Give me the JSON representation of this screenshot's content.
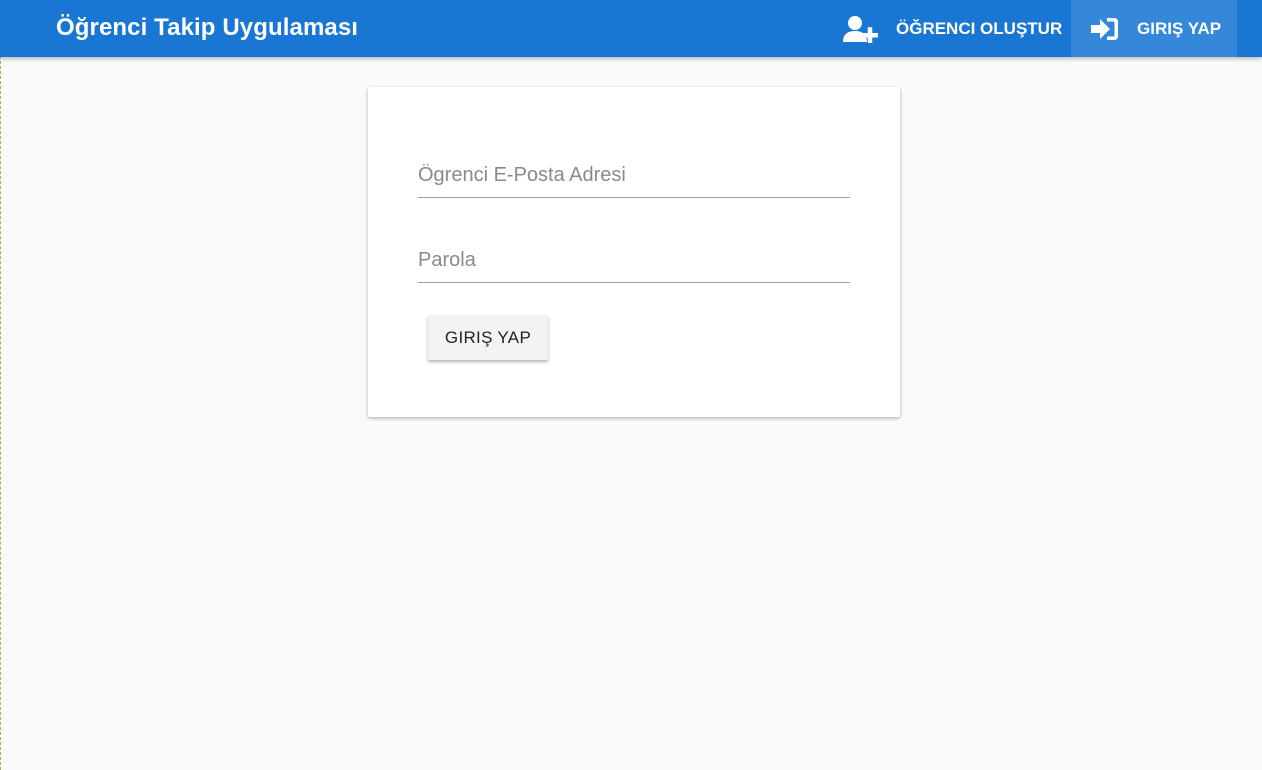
{
  "app": {
    "title": "Öğrenci Takip Uygulaması",
    "colors": {
      "header": "#1976d2",
      "active_nav": "#3487d9",
      "background": "#fafafa"
    }
  },
  "nav": {
    "register": {
      "label": "ÖĞRENCI OLUŞTUR",
      "icon": "user-plus-icon"
    },
    "login": {
      "label": "GIRIŞ YAP",
      "icon": "sign-in-icon",
      "active": true
    }
  },
  "form": {
    "email": {
      "placeholder": "Ögrenci E-Posta Adresi",
      "value": ""
    },
    "password": {
      "placeholder": "Parola",
      "value": ""
    },
    "submit_label": "GIRIŞ YAP"
  }
}
